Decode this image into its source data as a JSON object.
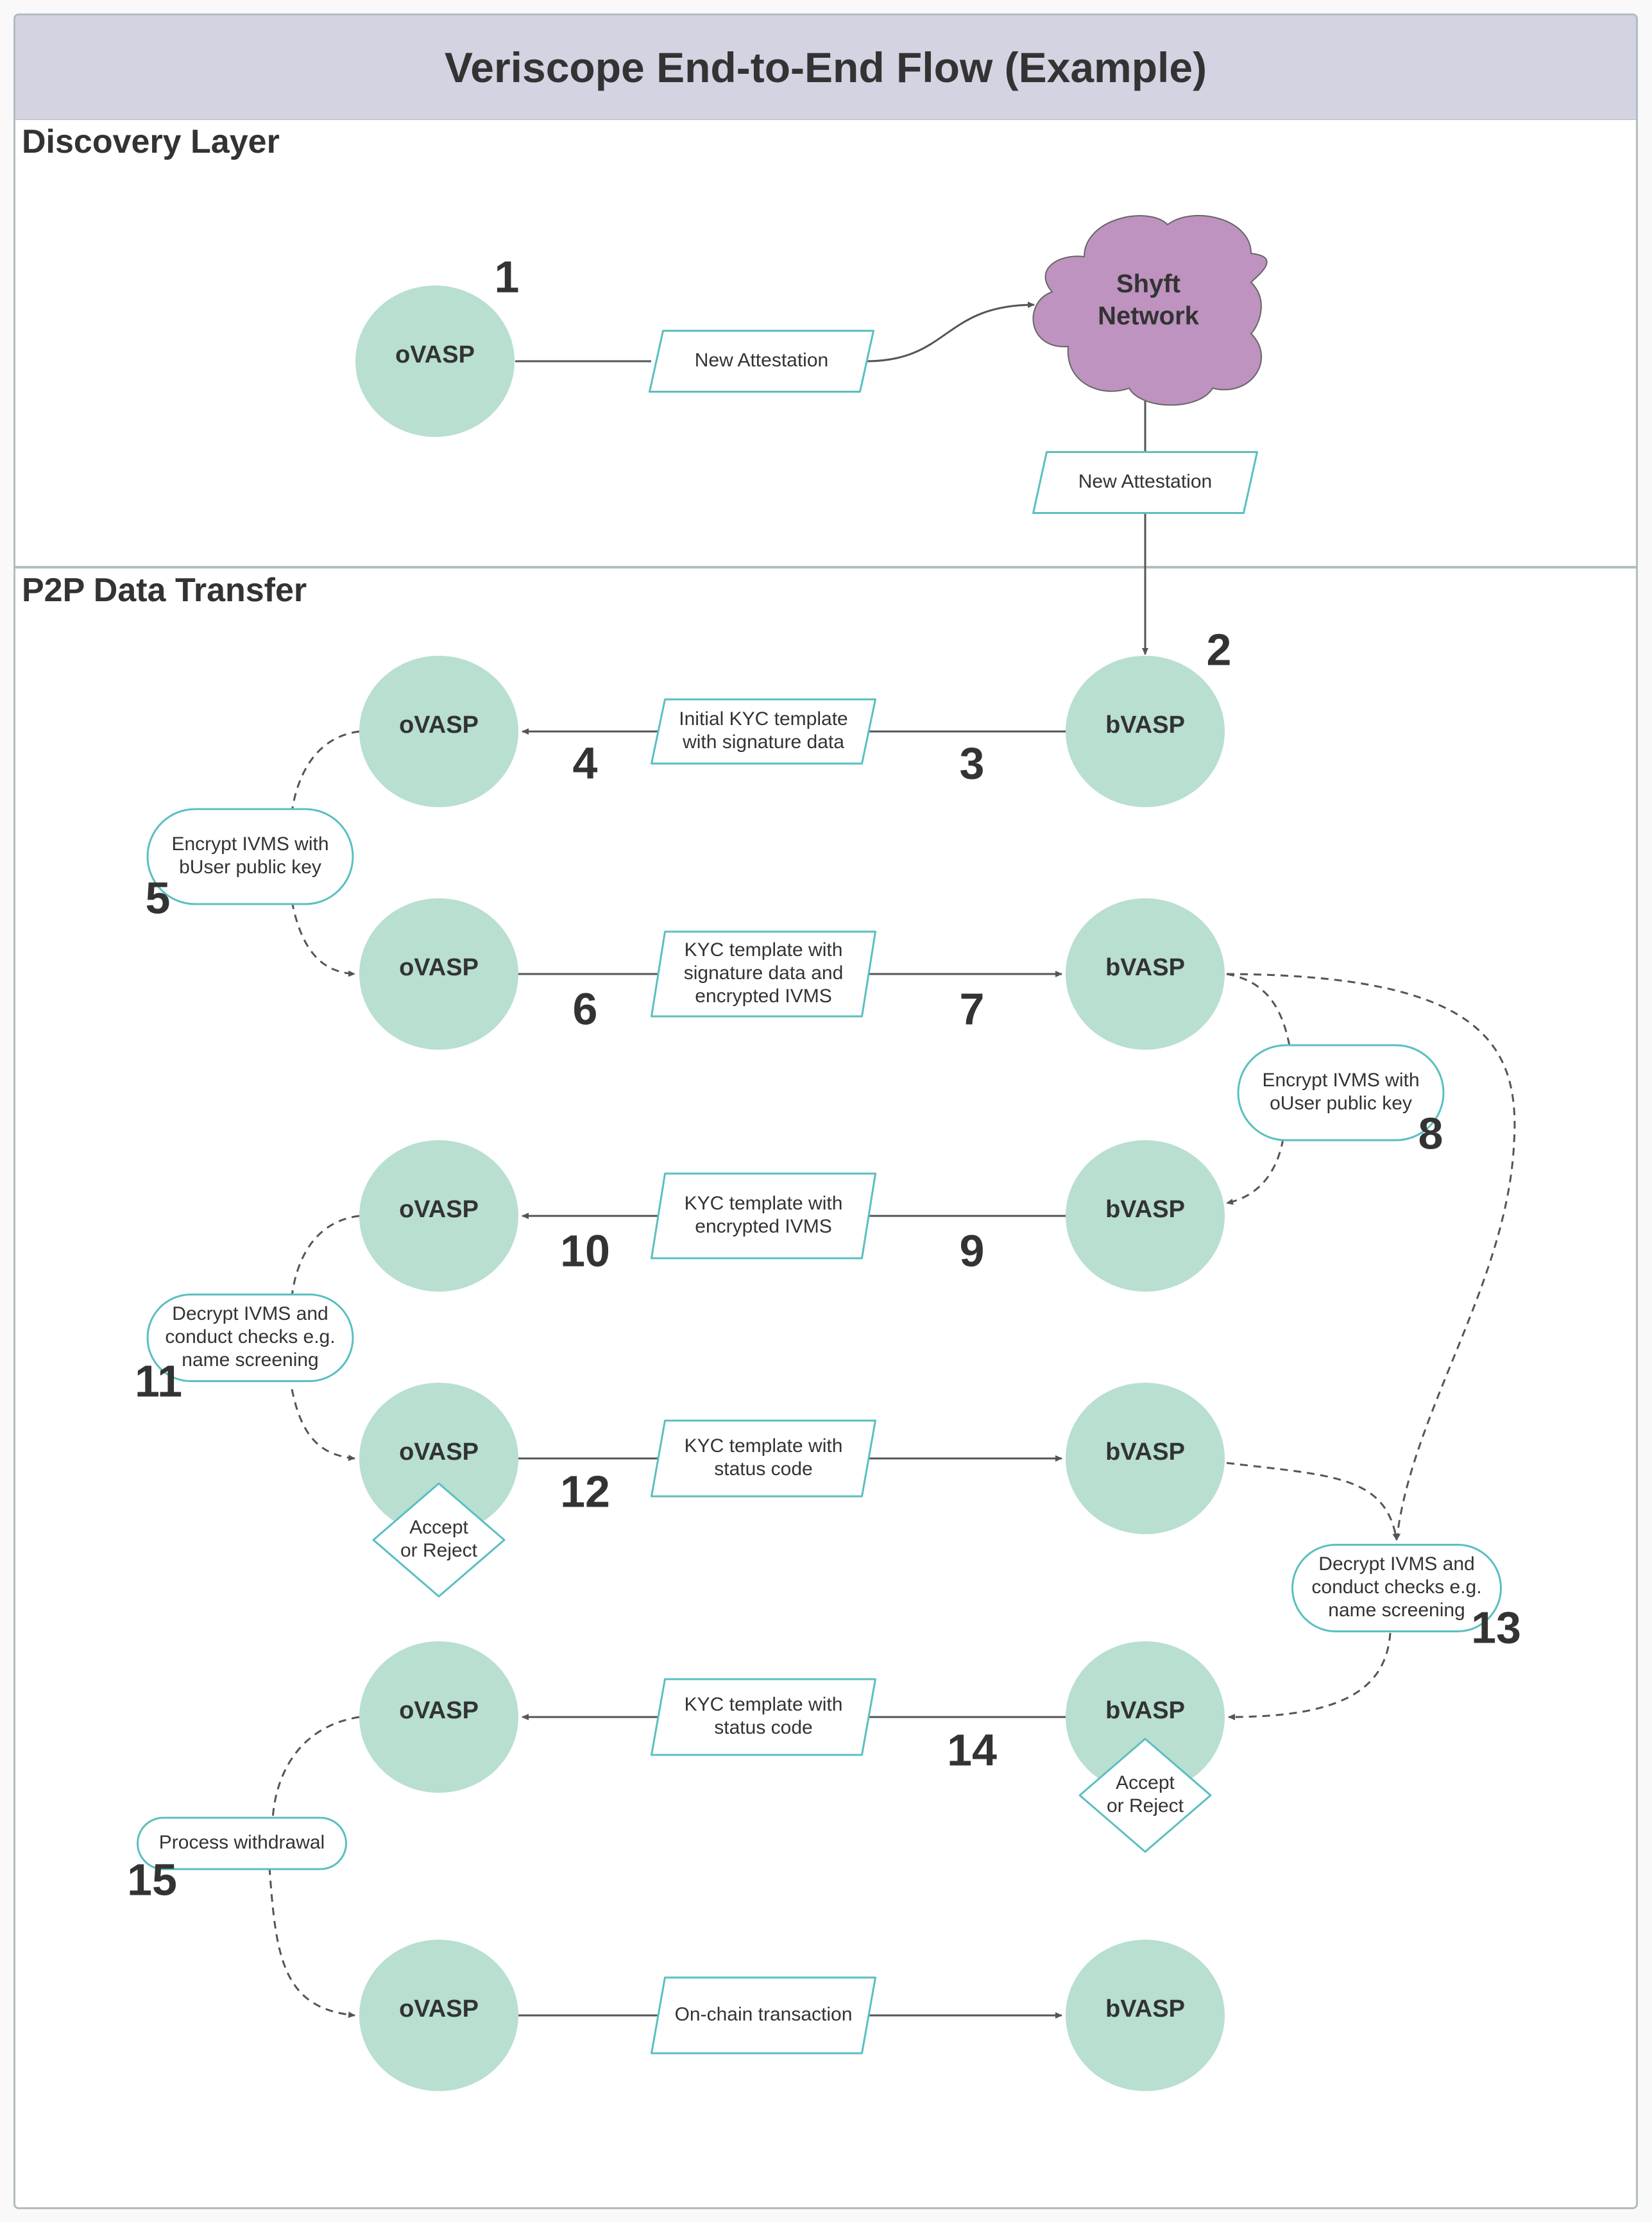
{
  "title": "Veriscope End-to-End Flow (Example)",
  "colors": {
    "node_fill": "#b8dfd0",
    "cloud_fill": "#be93bf",
    "box_border": "#5bbfbf",
    "title_fill": "#d4d3e2",
    "line": "#555555"
  },
  "lanes": {
    "discovery": "Discovery Layer",
    "p2p": "P2P Data Transfer"
  },
  "nodes": {
    "discovery_ovasp": "oVASP",
    "shyft_line1": "Shyft",
    "shyft_line2": "Network",
    "rows": [
      {
        "left": "oVASP",
        "right": "bVASP"
      },
      {
        "left": "oVASP",
        "right": "bVASP"
      },
      {
        "left": "oVASP",
        "right": "bVASP"
      },
      {
        "left": "oVASP",
        "right": "bVASP"
      },
      {
        "left": "oVASP",
        "right": "bVASP"
      },
      {
        "left": "oVASP",
        "right": "bVASP"
      }
    ]
  },
  "messages": {
    "new_attestation_1": [
      "New Attestation"
    ],
    "new_attestation_2": [
      "New Attestation"
    ],
    "row1": [
      "Initial KYC template",
      "with signature data"
    ],
    "row2": [
      "KYC template with",
      "signature data and",
      "encrypted IVMS"
    ],
    "row3": [
      "KYC template with",
      "encrypted IVMS"
    ],
    "row4": [
      "KYC template with",
      "status code"
    ],
    "row5": [
      "KYC template with",
      "status code"
    ],
    "row6": [
      "On-chain transaction"
    ]
  },
  "processes": {
    "p5": [
      "Encrypt IVMS with",
      "bUser public key"
    ],
    "p8": [
      "Encrypt IVMS with",
      "oUser public key"
    ],
    "p11": [
      "Decrypt IVMS and",
      "conduct checks e.g.",
      "name screening"
    ],
    "p13": [
      "Decrypt IVMS and",
      "conduct checks e.g.",
      "name screening"
    ],
    "p15": [
      "Process withdrawal"
    ]
  },
  "decisions": {
    "d12": [
      "Accept",
      "or Reject"
    ],
    "d14": [
      "Accept",
      "or Reject"
    ]
  },
  "steps": [
    "1",
    "2",
    "3",
    "4",
    "5",
    "6",
    "7",
    "8",
    "9",
    "10",
    "11",
    "12",
    "13",
    "14",
    "15"
  ]
}
